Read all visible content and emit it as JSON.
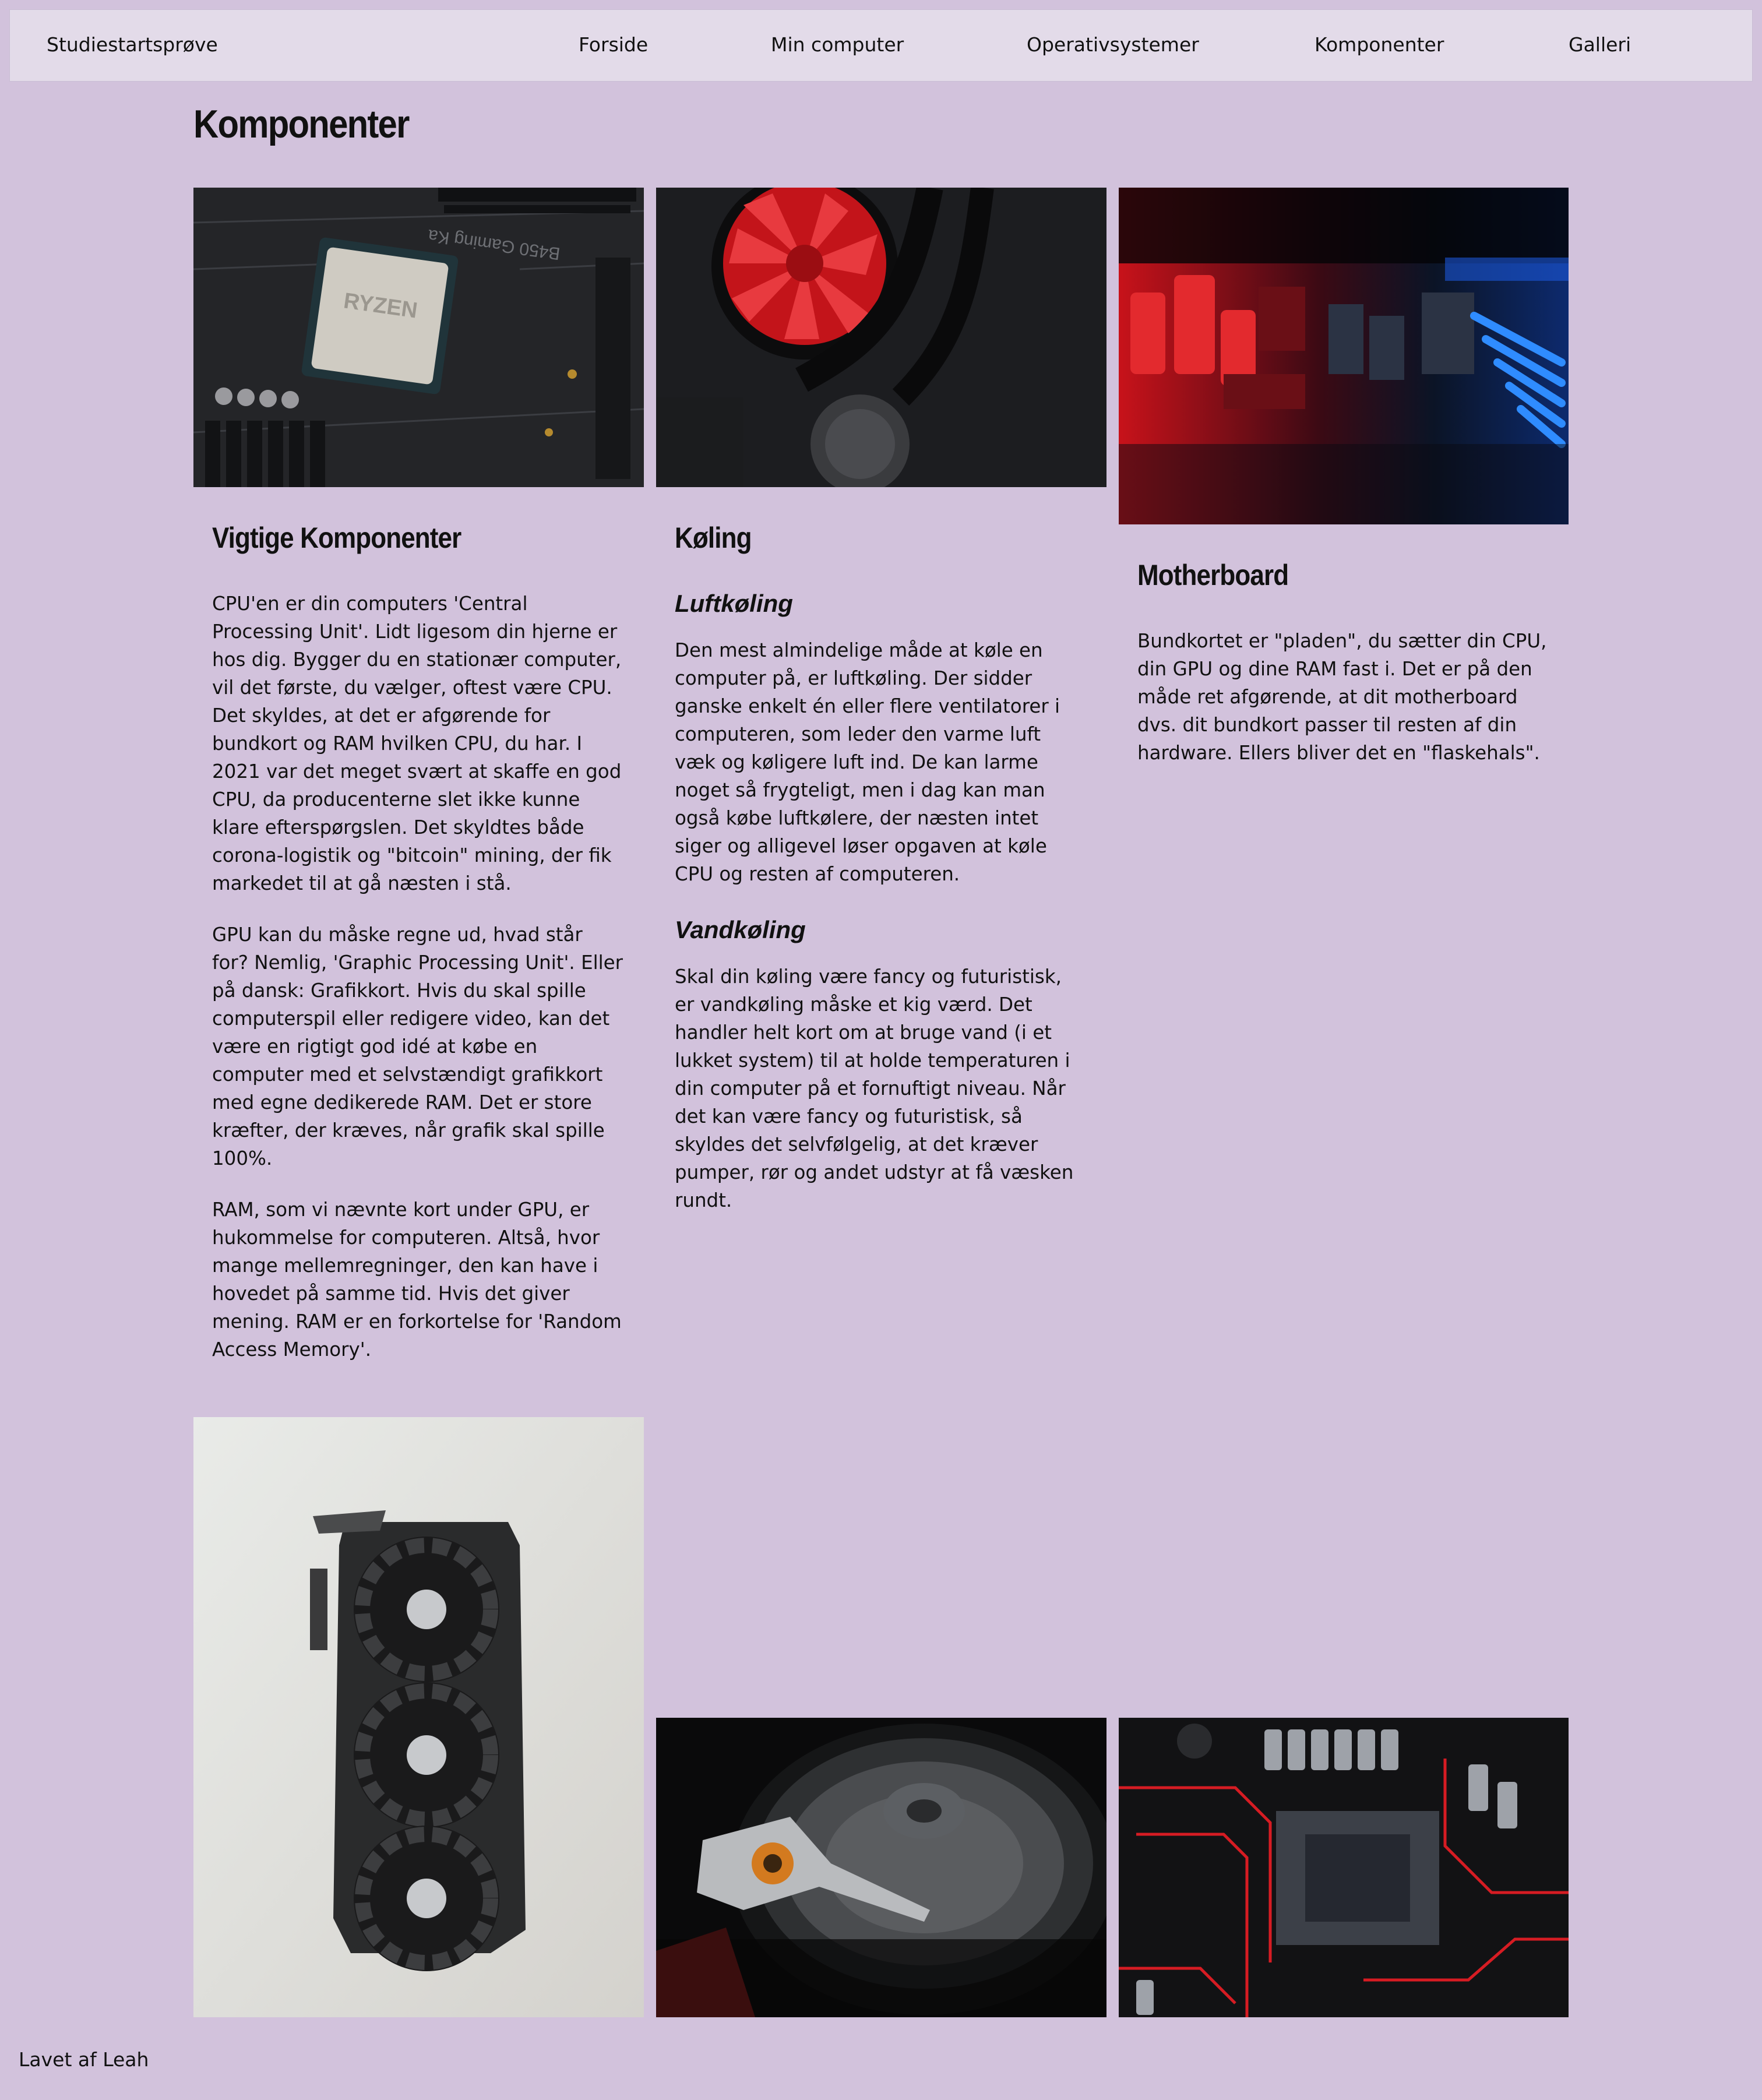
{
  "nav": {
    "brand": "Studiestartsprøve",
    "links": [
      "Forside",
      "Min computer",
      "Operativsystemer",
      "Komponenter",
      "Galleri"
    ]
  },
  "page": {
    "title": "Komponenter"
  },
  "columns": {
    "vigtige": {
      "title": "Vigtige Komponenter",
      "paragraphs": [
        "CPU'en er din computers 'Central Processing Unit'. Lidt ligesom din hjerne er hos dig. Bygger du en stationær computer, vil det første, du vælger, oftest være CPU. Det skyldes, at det er afgørende for bundkort og RAM hvilken CPU, du har. I 2021 var det meget svært at skaffe en god CPU, da producenterne slet ikke kunne klare efterspørgslen. Det skyldtes både corona-logistik og \"bitcoin\" mining, der fik markedet til at gå næsten i stå.",
        "GPU kan du måske regne ud, hvad står for? Nemlig, 'Graphic Processing Unit'. Eller på dansk: Grafikkort. Hvis du skal spille computerspil eller redigere video, kan det være en rigtigt god idé at købe en computer med et selvstændigt grafikkort med egne dedikerede RAM. Det er store kræfter, der kræves, når grafik skal spille 100%.",
        "RAM, som vi nævnte kort under GPU, er hukommelse for computeren. Altså, hvor mange mellemregninger, den kan have i hovedet på samme tid. Hvis det giver mening. RAM er en forkortelse for 'Random Access Memory'."
      ]
    },
    "koling": {
      "title": "Køling",
      "sub1": "Luftkøling",
      "p1": "Den mest almindelige måde at køle en computer på, er luftkøling. Der sidder ganske enkelt én eller flere ventilatorer i computeren, som leder den varme luft væk og køligere luft ind. De kan larme noget så frygteligt, men i dag kan man også købe luftkølere, der næsten intet siger og alligevel løser opgaven at køle CPU og resten af computeren.",
      "sub2": "Vandkøling",
      "p2": "Skal din køling være fancy og futuristisk, er vandkøling måske et kig værd. Det handler helt kort om at bruge vand (i et lukket system) til at holde temperaturen i din computer på et fornuftigt niveau. Når det kan være fancy og futuristisk, så skyldes det selvfølgelig, at det kræver pumper, rør og andet udstyr at få væsken rundt."
    },
    "motherboard": {
      "title": "Motherboard",
      "p1": "Bundkortet er \"pladen\", du sætter din CPU, din GPU og dine RAM fast i. Det er på den måde ret afgørende, at dit motherboard dvs. dit bundkort passer til resten af din hardware. Ellers bliver det en \"flaskehals\"."
    }
  },
  "photos": {
    "cpu_chip_text": "RYZEN",
    "board_text": "B450 Gaming Ka"
  },
  "footer": {
    "text": "Lavet af Leah"
  }
}
